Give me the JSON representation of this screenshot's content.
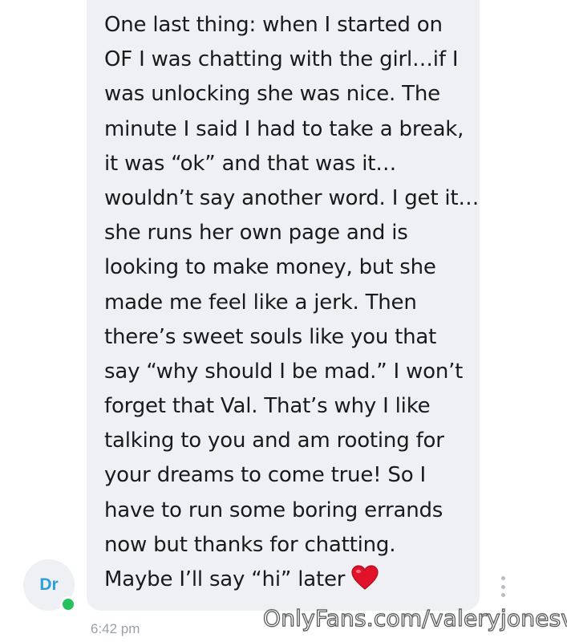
{
  "message": {
    "lines": [
      "One last thing: when I started on",
      "OF I was chatting with the girl…if I",
      "was unlocking she was nice. The",
      "minute I said I had to take a break,",
      "it was “ok” and that was it…",
      "wouldn’t say another word. I get it…",
      "she runs her own page and is",
      "looking to make money, but she",
      "made me feel like a jerk. Then",
      "there’s sweet souls like you that",
      "say “why should I be mad.” I won’t",
      "forget that Val. That’s why I like",
      "talking to you and am rooting for",
      "your dreams to come true! So I",
      "have to run some boring errands",
      "now but thanks for chatting.",
      "Maybe I’ll say “hi” later"
    ],
    "emoji": "red-heart-emoji",
    "timestamp": "6:42 pm"
  },
  "sender": {
    "initials": "Dr",
    "status_color": "#25c15a",
    "initials_color": "#2a9fd8"
  },
  "colors": {
    "bubble": "#eef0f3",
    "text": "#1a1a1a",
    "timestamp": "#9aa1ab"
  },
  "watermark": "OnlyFans.com/valeryjonesvip"
}
